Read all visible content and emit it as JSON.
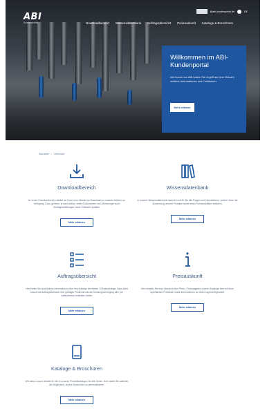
{
  "header": {
    "logo_text": "ABI",
    "logo_subtext": "Kundenportal",
    "nav": [
      "Downloadbereich",
      "Wissensdatenbank",
      "Auftragsübersicht",
      "Preisauskunft",
      "Kataloge & Broschüren"
    ],
    "account_email": "@abi-kundenportal.de",
    "account_language": "DE"
  },
  "hero": {
    "title": "Willkommen im ABI-Kundenportal",
    "text": "Als Kunde von ABI haben Sie Zugriff auf eine Vielzahl weiterer Informationen und Funktionen.",
    "button": "Mehr erfahren"
  },
  "breadcrumb": [
    "Startseite",
    "Übersicht"
  ],
  "cards": [
    {
      "icon": "download-icon",
      "title": "Downloadbereich",
      "desc": "Im neuen Downloadbereich stellen wir Ihnen eine Vielzahl an Downloads zu unseren Artikeln zur Verfügung. Dazu gehören, je nach Artikel, neben Dokumenten und Zeichnungen auch Montageanleitungen sowie Software-Updates.",
      "button": "Mehr erfahren"
    },
    {
      "icon": "books-icon",
      "title": "Wissensdatenbank",
      "desc": "In unserer Wissensdatenbank sammeln wir für Sie alle Fragen und Informationen, welche Ihnen die Anwendung unserer Produkte sowie deren Funktionalitäten erläutern.",
      "button": "Mehr erfahren"
    },
    {
      "icon": "list-icon",
      "title": "Auftragsübersicht",
      "desc": "Hier finden Sie ausführliche Informationen über Ihre Aufträge der letzten 12 Kalendertage. Dazu zählt sowohl die Auftragsübersicht über getätigte Positionen als die Sendungsverfolgung aller per Lieferadresse bestellten Artikel.",
      "button": "Mehr erfahren"
    },
    {
      "icon": "info-icon",
      "title": "Preisauskunft",
      "desc": "Hier erhalten Sie eine Übersicht über Preis- / Preisangaben unserer Kataloge über mit Ihren spezifischen Preislisten sowie Informationen zu deren Lagerverfügbarkeit.",
      "button": "Mehr erfahren"
    },
    {
      "icon": "catalog-icon",
      "title": "Kataloge & Broschüren",
      "desc": "Wir haben unsere Inhalte für Sie in unseren Produktkatalogen für alle Serien. Dort haben Sie natürlich die Möglichkeit, unsere Broschüren zu personalisieren.",
      "button": "Mehr erfahren"
    }
  ],
  "colors": {
    "brand": "#1e56a0",
    "text": "#3b5a82"
  }
}
